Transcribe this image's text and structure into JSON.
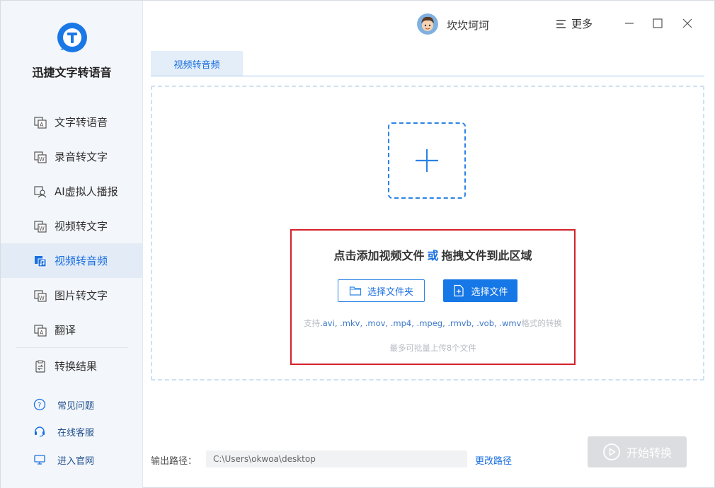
{
  "app": {
    "name": "迅捷文字转语音",
    "brand_color": "#1a78e6"
  },
  "sidebar": {
    "items": [
      {
        "label": "文字转语音",
        "icon": "text-to-speech-icon",
        "active": false
      },
      {
        "label": "录音转文字",
        "icon": "audio-to-text-icon",
        "active": false
      },
      {
        "label": "AI虚拟人播报",
        "icon": "ai-avatar-icon",
        "active": false
      },
      {
        "label": "视频转文字",
        "icon": "video-to-text-icon",
        "active": false
      },
      {
        "label": "视频转音频",
        "icon": "video-to-audio-icon",
        "active": true
      },
      {
        "label": "图片转文字",
        "icon": "image-to-text-icon",
        "active": false
      },
      {
        "label": "翻译",
        "icon": "translate-icon",
        "active": false
      },
      {
        "label": "转换结果",
        "icon": "results-icon",
        "active": false
      }
    ],
    "help": [
      {
        "label": "常见问题",
        "icon": "question-icon"
      },
      {
        "label": "在线客服",
        "icon": "headset-icon"
      },
      {
        "label": "进入官网",
        "icon": "monitor-icon"
      }
    ]
  },
  "header": {
    "username": "坎坎坷坷",
    "more_label": "更多"
  },
  "tab": {
    "label": "视频转音频"
  },
  "dropzone": {
    "headline_left": "点击添加视频文件",
    "headline_or": "或",
    "headline_right": "拖拽文件到此区域",
    "select_folder": "选择文件夹",
    "select_file": "选择文件",
    "formats_prefix": "支持",
    "formats": ".avi, .mkv, .mov, .mp4, .mpeg, .rmvb, .vob, .wmv",
    "formats_suffix": "格式的转换",
    "limit": "最多可批量上传8个文件"
  },
  "footer": {
    "output_label": "输出路径：",
    "output_path": "C:\\Users\\okwoa\\desktop",
    "change_path": "更改路径",
    "start_label": "开始转换"
  }
}
